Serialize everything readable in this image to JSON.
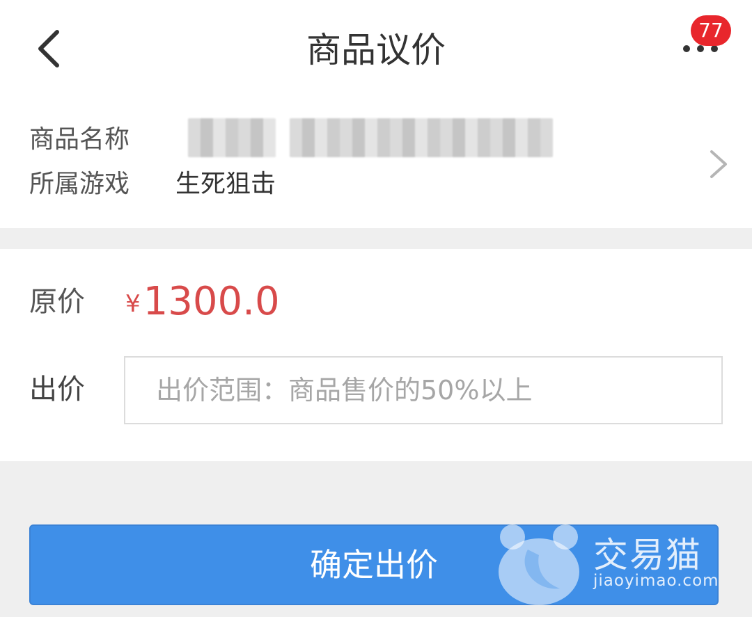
{
  "header": {
    "title": "商品议价",
    "back_icon": "chevron-left-icon",
    "more_icon": "more-dots-icon",
    "notification_count": "77"
  },
  "product": {
    "name_label": "商品名称",
    "name_value_redacted": true,
    "game_label": "所属游戏",
    "game_value": "生死狙击",
    "detail_icon": "chevron-right-icon"
  },
  "pricing": {
    "original_label": "原价",
    "currency_symbol": "¥",
    "original_price": "1300.0",
    "bid_label": "出价",
    "bid_value": "",
    "bid_placeholder": "出价范围：商品售价的50%以上"
  },
  "actions": {
    "confirm_label": "确定出价"
  },
  "watermark": {
    "brand": "交易猫",
    "url": "jiaoyimao.com"
  },
  "colors": {
    "price_red": "#d84a4a",
    "badge_red": "#e8262c",
    "button_blue": "#3f8fe8",
    "page_background": "#efefef"
  }
}
